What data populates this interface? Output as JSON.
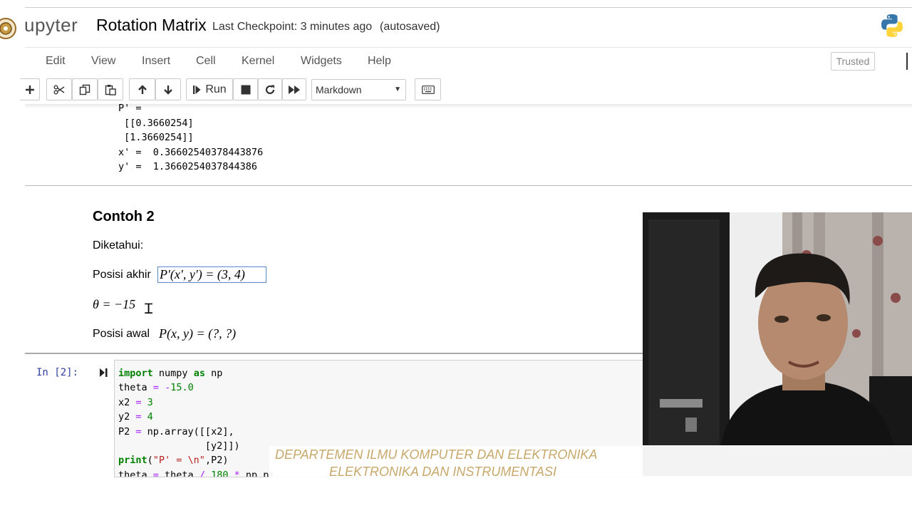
{
  "header": {
    "brand": "upyter",
    "notebook_title": "Rotation Matrix",
    "checkpoint": "Last Checkpoint: 3 minutes ago",
    "autosaved": "(autosaved)"
  },
  "menu": [
    "Edit",
    "View",
    "Insert",
    "Cell",
    "Kernel",
    "Widgets",
    "Help"
  ],
  "trusted_label": "Trusted",
  "toolbar": {
    "run_label": "Run",
    "cell_type": "Markdown"
  },
  "output": {
    "lines": [
      "P' =",
      " [[0.3660254]",
      " [1.3660254]]",
      "x' =  0.36602540378443876",
      "y' =  1.3660254037844386"
    ]
  },
  "markdown": {
    "heading": "Contoh 2",
    "diketahui": "Diketahui:",
    "posisi_akhir_label": "Posisi akhir",
    "posisi_akhir_math": "P′(x′, y′) = (3, 4)",
    "theta_math": "θ = −15",
    "posisi_awal_label": "Posisi awal",
    "posisi_awal_math": "P(x, y) = (?, ?)"
  },
  "code_cell": {
    "prompt": "In [2]:"
  },
  "watermark": {
    "line1": "DEPARTEMEN ILMU KOMPUTER DAN ELEKTRONIKA",
    "line2": "ELEKTRONIKA DAN INSTRUMENTASI"
  },
  "colors": {
    "prompt_in": "#303f9f",
    "keyword": "#008000",
    "operator": "#aa22ff",
    "string": "#ba2121",
    "watermark": "#c8a86a"
  }
}
